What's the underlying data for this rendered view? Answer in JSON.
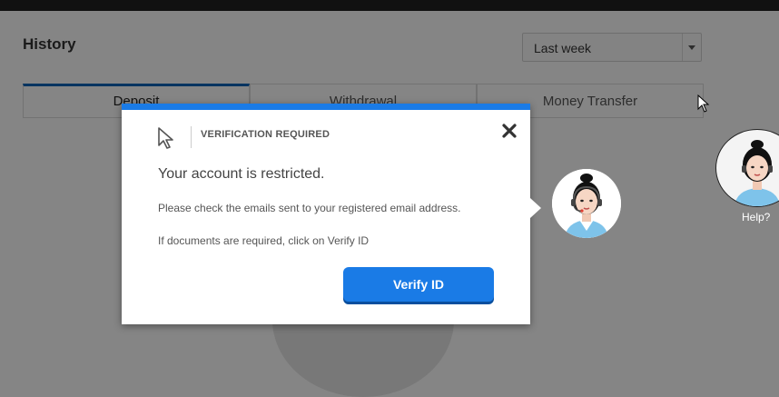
{
  "page": {
    "title": "History",
    "period_select": {
      "selected": "Last week"
    },
    "tabs": [
      {
        "label": "Deposit",
        "active": true
      },
      {
        "label": "Withdrawal",
        "active": false
      },
      {
        "label": "Money Transfer",
        "active": false
      }
    ]
  },
  "modal": {
    "header": "VERIFICATION REQUIRED",
    "heading": "Your account is restricted.",
    "message_1": "Please check the emails sent to your registered email address.",
    "message_2": "If documents are required, click on Verify ID",
    "verify_button": "Verify ID"
  },
  "help_widget": {
    "label": "Help?"
  },
  "colors": {
    "accent": "#1a7be6",
    "tab_active": "#0b63b5",
    "overlay": "rgba(0,0,0,0.47)"
  },
  "icons": {
    "header": "cursor-arrow-icon",
    "close": "close-icon",
    "agent": "support-agent-avatar-icon"
  }
}
